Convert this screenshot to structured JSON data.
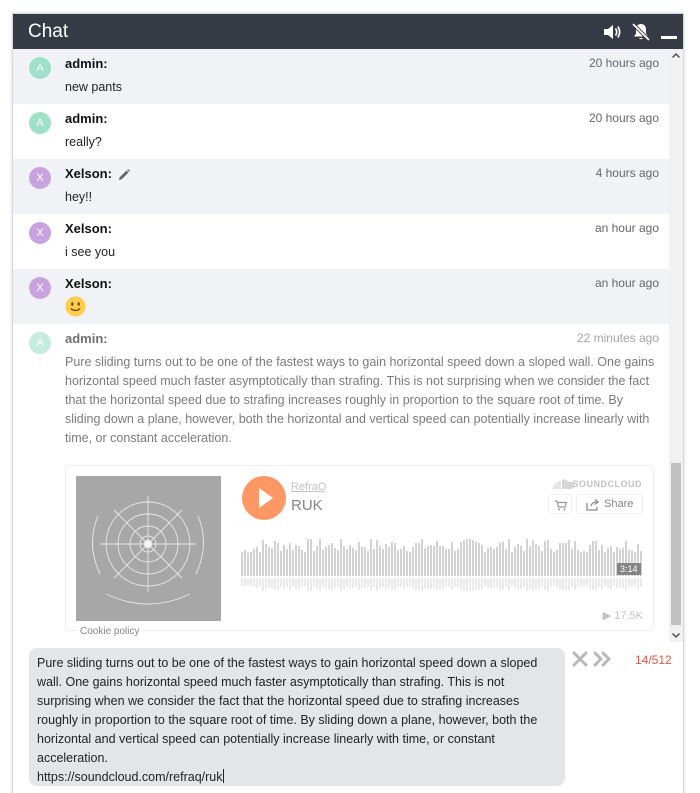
{
  "window": {
    "title": "Chat"
  },
  "header_icons": [
    "volume-icon",
    "bell-off-icon",
    "minimize-icon"
  ],
  "messages": [
    {
      "avatar": "A",
      "avatar_color": "#9fe0c9",
      "author": "admin:",
      "time": "20 hours ago",
      "text": "new pants"
    },
    {
      "avatar": "A",
      "avatar_color": "#9fe0c9",
      "author": "admin:",
      "time": "20 hours ago",
      "text": "really?"
    },
    {
      "avatar": "X",
      "avatar_color": "#c9a2e0",
      "author": "Xelson:",
      "time": "4 hours ago",
      "text": "hey!!",
      "edited_icon": "pencil-icon"
    },
    {
      "avatar": "X",
      "avatar_color": "#c9a2e0",
      "author": "Xelson:",
      "time": "an hour ago",
      "text": "i see you"
    },
    {
      "avatar": "X",
      "avatar_color": "#c9a2e0",
      "author": "Xelson:",
      "time": "an hour ago",
      "emoji": "slightly-smiling-face-icon"
    },
    {
      "avatar": "A",
      "avatar_color": "#9fe0c9",
      "author": "admin:",
      "time": "22 minutes ago",
      "text": "Pure sliding turns out to be one of the fastest ways to gain horizontal speed down a sloped wall. One gains horizontal speed much faster asymptotically than strafing. This is not surprising when we consider the fact that the horizontal speed due to strafing increases roughly in proportion to the square root of time. By sliding down a plane, however, both the horizontal and vertical speed can potentially increase linearly with time, or constant acceleration."
    }
  ],
  "soundcloud": {
    "artist": "RefraQ",
    "track": "RUK",
    "brand": "SOUNDCLOUD",
    "share_label": "Share",
    "duration": "3:14",
    "plays": "17.5K",
    "cookie_label": "Cookie policy",
    "accent_color": "#ff5500"
  },
  "composer": {
    "text": "Pure sliding turns out to be one of the fastest ways to gain horizontal speed down a sloped wall. One gains horizontal speed much faster asymptotically than strafing. This is not surprising when we consider the fact that the horizontal speed due to strafing increases roughly in proportion to the square root of time. By sliding down a plane, however, both the horizontal and vertical speed can potentially increase linearly with time, or constant acceleration.\nhttps://soundcloud.com/refraq/ruk",
    "char_count": "14/512",
    "count_color": "#e2574c"
  }
}
